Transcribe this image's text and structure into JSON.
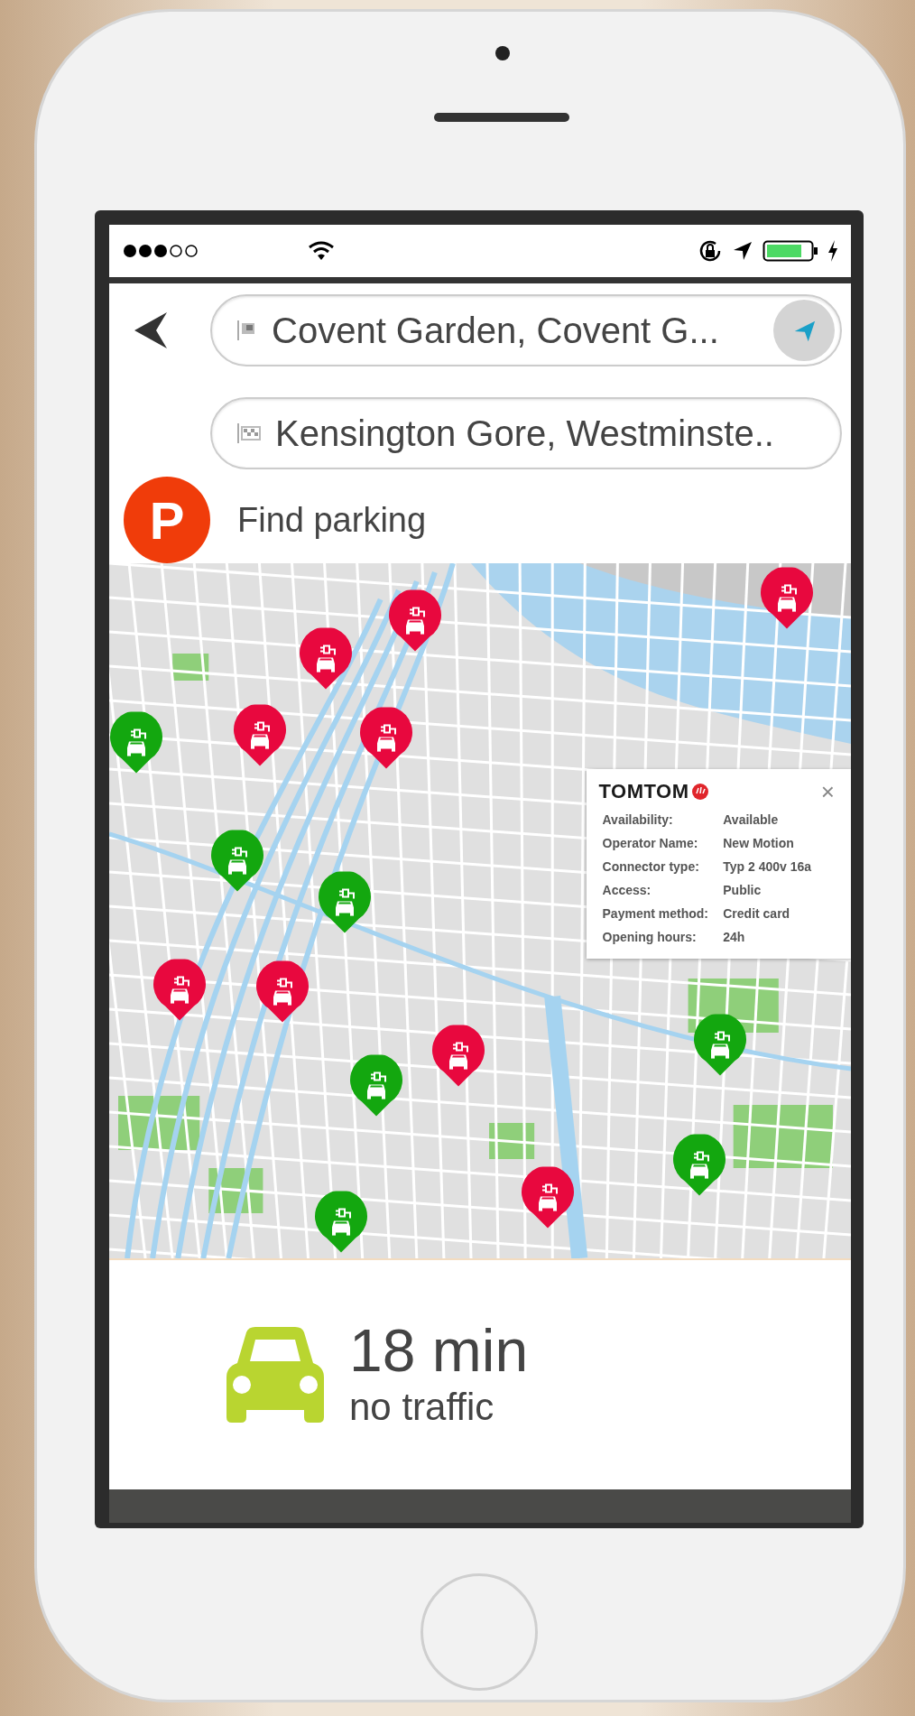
{
  "route": {
    "from": {
      "value": "Covent Garden, Covent G..."
    },
    "to": {
      "value": "Kensington Gore, Westminste.."
    }
  },
  "parking": {
    "badge": "P",
    "label": "Find parking"
  },
  "map": {
    "pins": [
      {
        "color": "#e8083e"
      },
      {
        "color": "#e8083e"
      },
      {
        "color": "#e8083e"
      },
      {
        "color": "#e8083e"
      },
      {
        "color": "#13a70f"
      },
      {
        "color": "#e8083e"
      },
      {
        "color": "#13a70f"
      },
      {
        "color": "#13a70f"
      },
      {
        "color": "#e8083e"
      },
      {
        "color": "#e8083e"
      },
      {
        "color": "#13a70f"
      },
      {
        "color": "#e8083e"
      },
      {
        "color": "#13a70f"
      },
      {
        "color": "#13a70f"
      },
      {
        "color": "#e8083e"
      },
      {
        "color": "#13a70f"
      }
    ],
    "popup": {
      "brand": "TOMTOM",
      "close": "×",
      "rows": [
        {
          "label": "Availability:",
          "value": "Available"
        },
        {
          "label": "Operator Name:",
          "value": "New Motion"
        },
        {
          "label": "Connector type:",
          "value": "Typ 2 400v 16a"
        },
        {
          "label": "Access:",
          "value": "Public"
        },
        {
          "label": "Payment method:",
          "value": "Credit card"
        },
        {
          "label": "Opening hours:",
          "value": "24h"
        }
      ]
    }
  },
  "trip": {
    "time": "18 min",
    "traffic": "no traffic"
  }
}
